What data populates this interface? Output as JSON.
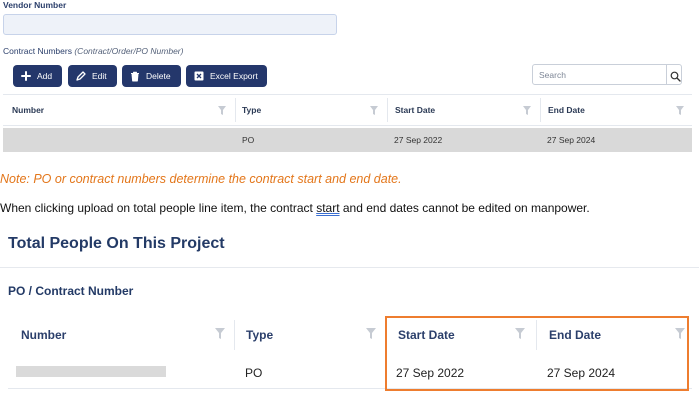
{
  "vendor": {
    "label": "Vendor Number",
    "value": ""
  },
  "contracts": {
    "label": "Contract Numbers",
    "hint": "(Contract/Order/PO Number)",
    "toolbar": {
      "add_label": "Add",
      "edit_label": "Edit",
      "delete_label": "Delete",
      "export_label": "Excel Export"
    },
    "search": {
      "placeholder": "Search"
    },
    "columns": [
      "Number",
      "Type",
      "Start Date",
      "End Date"
    ],
    "rows": [
      {
        "number": "",
        "type": "PO",
        "start_date": "27 Sep 2022",
        "end_date": "27 Sep 2024"
      }
    ]
  },
  "note": "Note: PO or contract numbers determine the contract start and end date.",
  "description": {
    "before": "When clicking upload on total people line item, the contract ",
    "flagged_word": "start",
    "after": " and end dates cannot be edited on manpower."
  },
  "project": {
    "title": "Total People On This Project",
    "subtitle": "PO / Contract Number",
    "columns": [
      "Number",
      "Type",
      "Start Date",
      "End Date"
    ],
    "rows": [
      {
        "number": "",
        "type": "PO",
        "start_date": "27 Sep 2022",
        "end_date": "27 Sep 2024"
      }
    ]
  },
  "colors": {
    "button_bg": "#24376b",
    "highlight_border": "#ee7d2f",
    "note_text": "#e3761a",
    "selected_row": "#d9d9d9"
  },
  "icons": {
    "add": "plus-icon",
    "edit": "pencil-icon",
    "delete": "trash-icon",
    "export": "excel-icon",
    "search": "search-icon",
    "filter": "filter-icon"
  }
}
